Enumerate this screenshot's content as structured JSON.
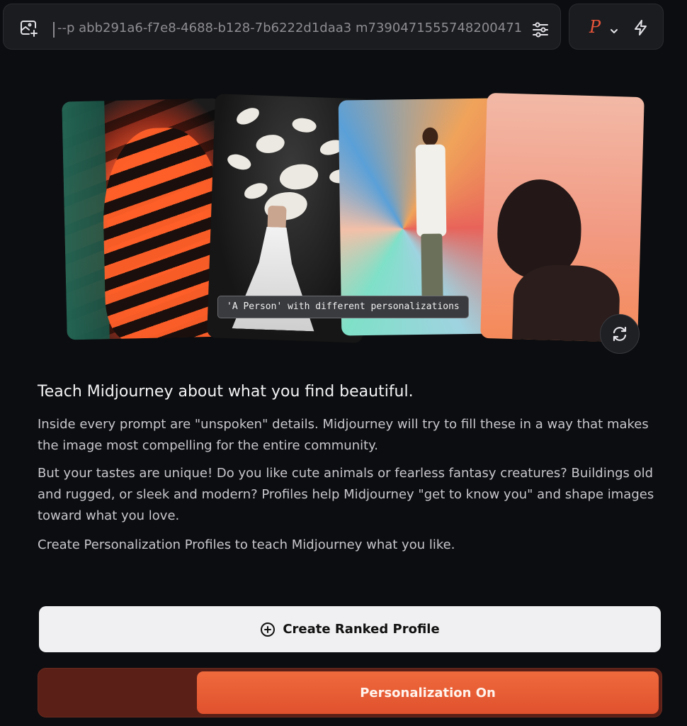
{
  "prompt_bar": {
    "prompt_text": "--p abb291a6-f7e8-4688-b128-7b6222d1daa3 m7390471555748200471"
  },
  "profile_bar": {
    "profile_letter": "P"
  },
  "gallery": {
    "caption": "'A Person' with different personalizations"
  },
  "content": {
    "headline": "Teach Midjourney about what you find beautiful.",
    "paragraph_1": "Inside every prompt are \"unspoken\" details. Midjourney will try to fill these in a way that makes the image most compelling for the entire community.",
    "paragraph_2": "But your tastes are unique! Do you like cute animals or fearless fantasy creatures? Buildings old and rugged, or sleek and modern? Profiles help Midjourney \"get to know you\" and shape images toward what you love.",
    "paragraph_3": "Create Personalization Profiles to teach Midjourney what you like."
  },
  "actions": {
    "create_ranked_profile_label": "Create Ranked Profile",
    "personalization_label": "Personalization On",
    "personalization_enabled": true
  },
  "colors": {
    "accent": "#e8553a",
    "background": "#0c0d10"
  }
}
